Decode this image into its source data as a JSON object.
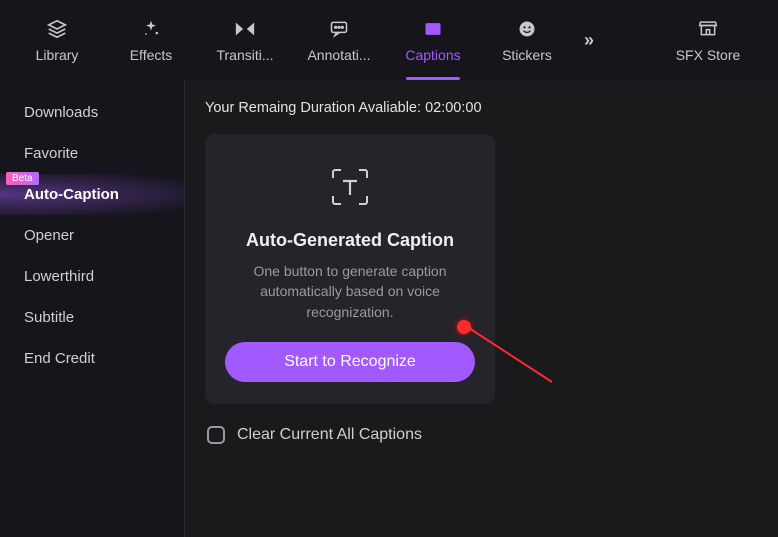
{
  "tabs": {
    "library": "Library",
    "effects": "Effects",
    "transitions": "Transiti...",
    "annotations": "Annotati...",
    "captions": "Captions",
    "stickers": "Stickers",
    "sfx": "SFX Store"
  },
  "sidebar": {
    "downloads": "Downloads",
    "favorite": "Favorite",
    "auto_caption": "Auto-Caption",
    "beta": "Beta",
    "opener": "Opener",
    "lowerthird": "Lowerthird",
    "subtitle": "Subtitle",
    "end_credit": "End Credit"
  },
  "content": {
    "duration_label": "Your Remaing Duration Avaliable: ",
    "duration_value": "02:00:00",
    "card_title": "Auto-Generated Caption",
    "card_desc": "One button to generate caption automatically based on voice recognization.",
    "button": "Start to Recognize",
    "clear": "Clear Current All Captions"
  },
  "colors": {
    "accent": "#a259ff",
    "annotation": "#ff2b2b"
  }
}
